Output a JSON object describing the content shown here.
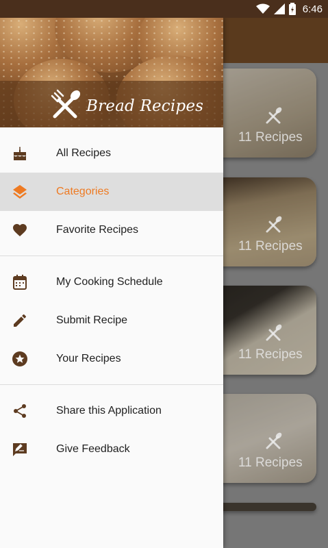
{
  "status_bar": {
    "time": "6:46"
  },
  "drawer": {
    "app_title": "Bread Recipes",
    "sections": [
      [
        {
          "label": "All Recipes",
          "icon": "cake-icon",
          "active": false
        },
        {
          "label": "Categories",
          "icon": "layers-icon",
          "active": true
        },
        {
          "label": "Favorite Recipes",
          "icon": "heart-icon",
          "active": false
        }
      ],
      [
        {
          "label": "My Cooking Schedule",
          "icon": "calendar-icon",
          "active": false
        },
        {
          "label": "Submit Recipe",
          "icon": "pencil-icon",
          "active": false
        },
        {
          "label": "Your Recipes",
          "icon": "star-circle-icon",
          "active": false
        }
      ],
      [
        {
          "label": "Share this Application",
          "icon": "share-icon",
          "active": false
        },
        {
          "label": "Give Feedback",
          "icon": "feedback-icon",
          "active": false
        }
      ]
    ]
  },
  "background_cards": [
    {
      "count_label": "11 Recipes"
    },
    {
      "count_label": "11 Recipes"
    },
    {
      "count_label": "11 Recipes"
    },
    {
      "count_label": "11 Recipes"
    }
  ],
  "colors": {
    "status_bar": "#4a2f1c",
    "toolbar": "#5a3a1d",
    "accent": "#ee7a22",
    "icon_brown": "#5d3b20",
    "active_bg": "#dedede"
  }
}
